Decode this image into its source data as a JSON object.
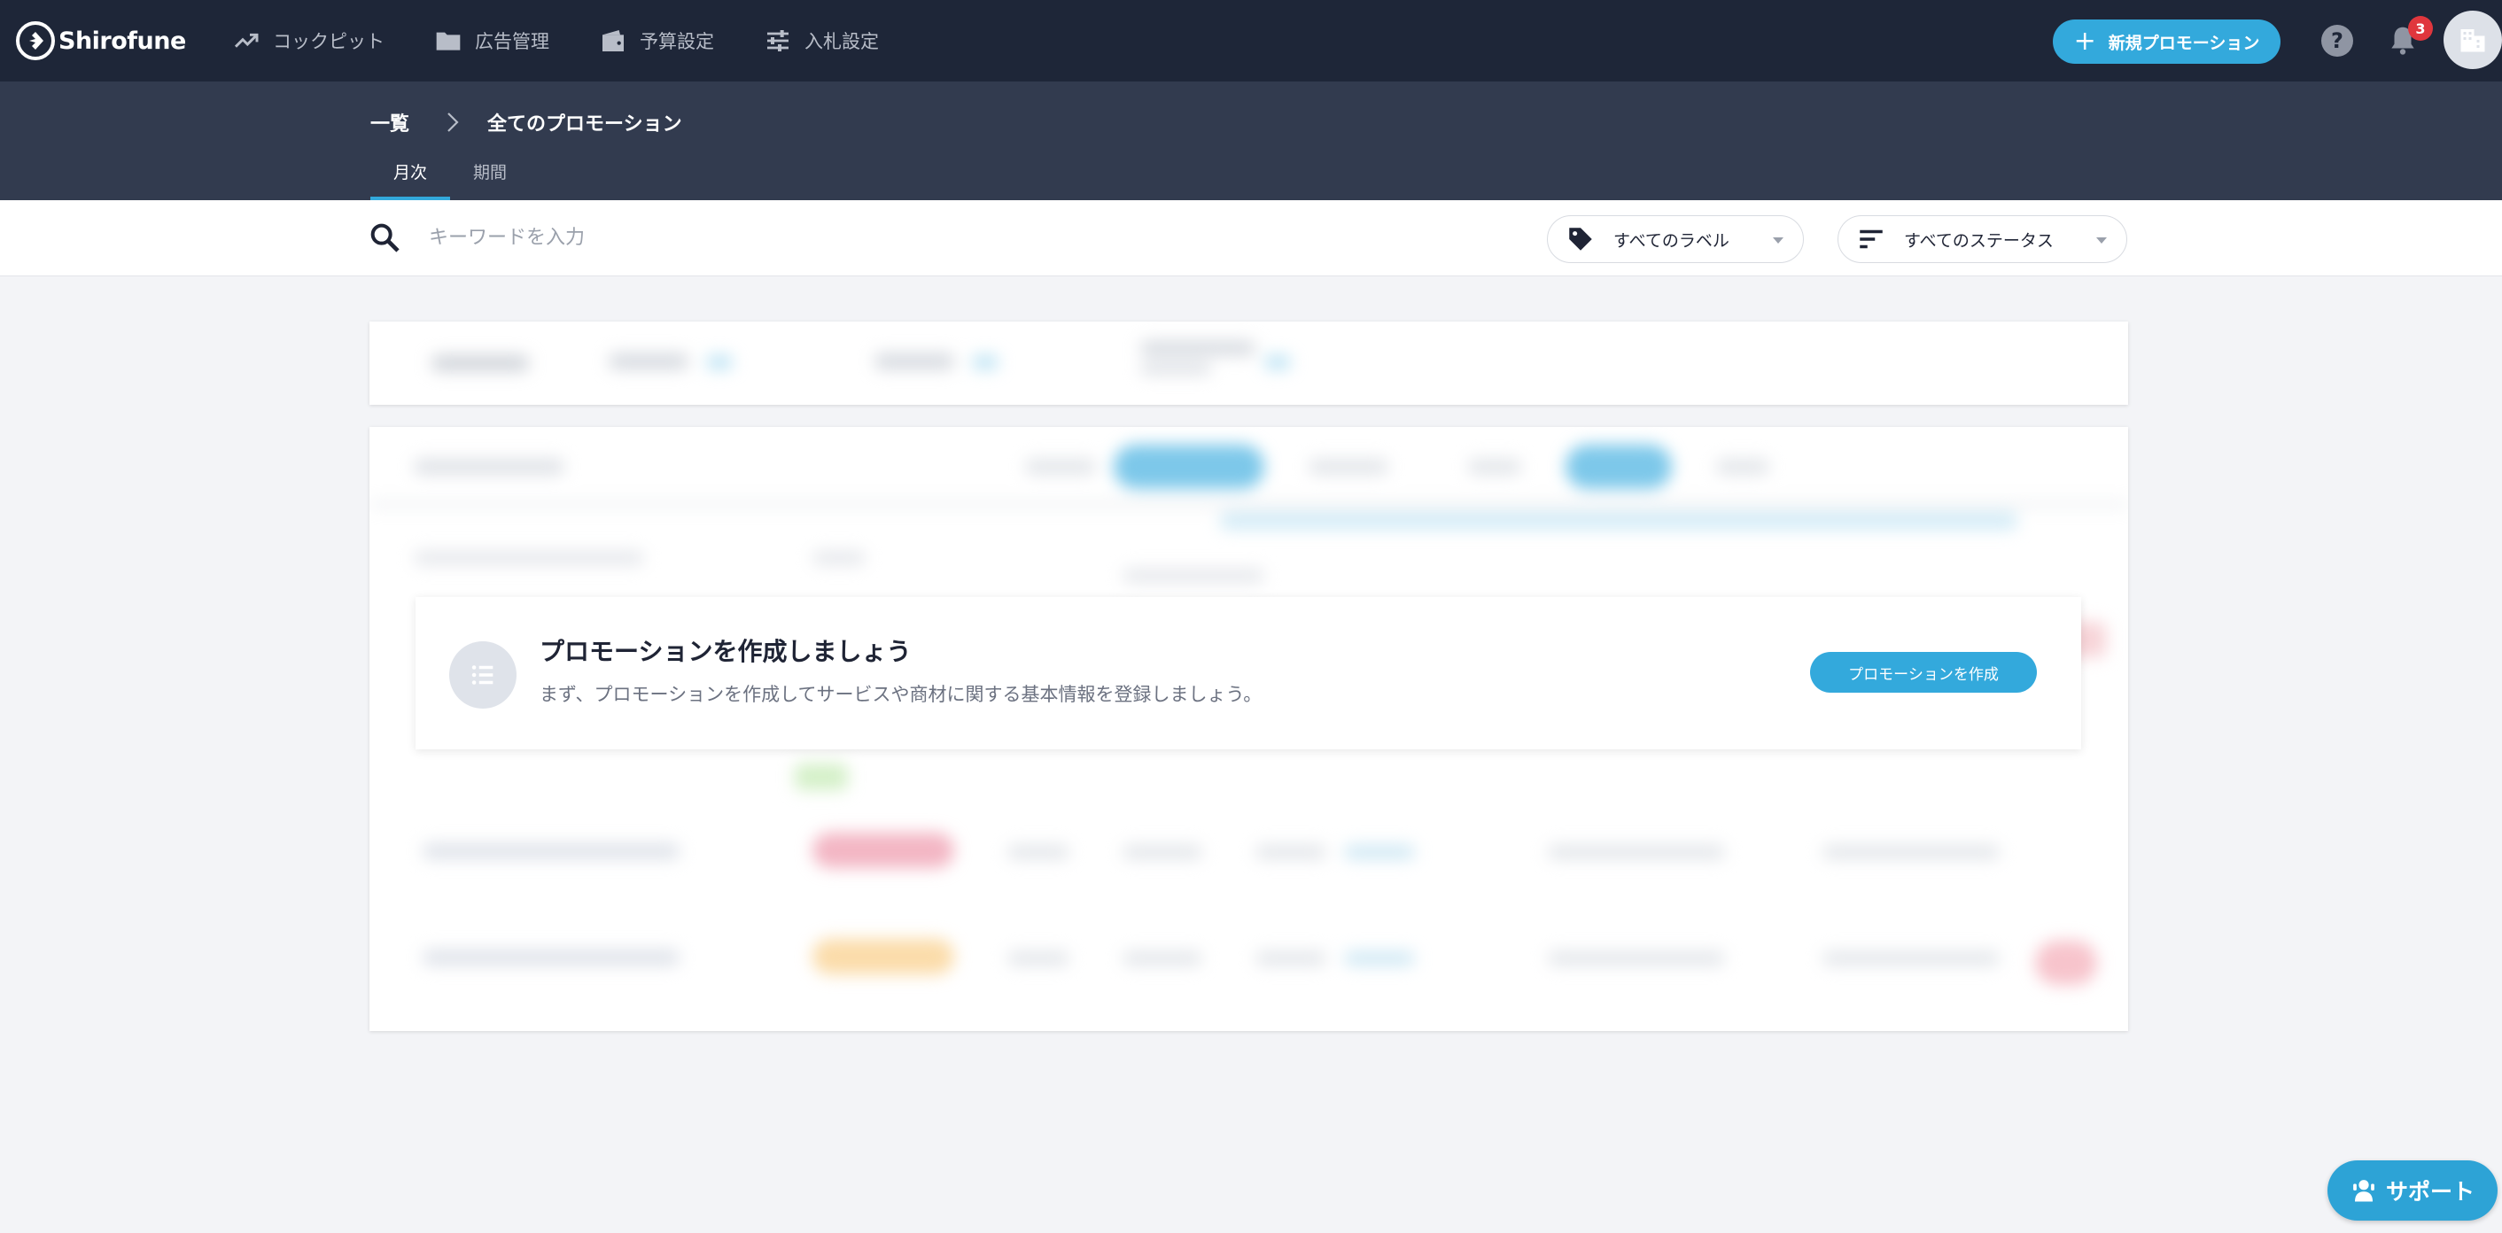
{
  "brand": {
    "name": "Shirofune"
  },
  "nav": {
    "items": [
      {
        "label": "コックピット",
        "icon": "trending-up-icon"
      },
      {
        "label": "広告管理",
        "icon": "folder-icon"
      },
      {
        "label": "予算設定",
        "icon": "wallet-icon"
      },
      {
        "label": "入札設定",
        "icon": "sliders-icon"
      }
    ],
    "new_promotion_label": "新規プロモーション",
    "notification_count": "3",
    "help_symbol": "?"
  },
  "breadcrumb": {
    "root": "一覧",
    "current": "全てのプロモーション"
  },
  "tabs": [
    {
      "label": "月次",
      "active": true
    },
    {
      "label": "期間",
      "active": false
    }
  ],
  "filters": {
    "search_placeholder": "キーワードを入力",
    "label_select": "すべてのラベル",
    "status_select": "すべてのステータス"
  },
  "empty_state": {
    "title": "プロモーションを作成しましょう",
    "description": "まず、プロモーションを作成してサービスや商材に関する基本情報を登録しましょう。",
    "button_label": "プロモーションを作成"
  },
  "support": {
    "label": "サポート"
  },
  "colors": {
    "nav_bg": "#1e2638",
    "subheader_bg": "#323b4f",
    "accent": "#33a9dc",
    "badge": "#e0363d"
  }
}
